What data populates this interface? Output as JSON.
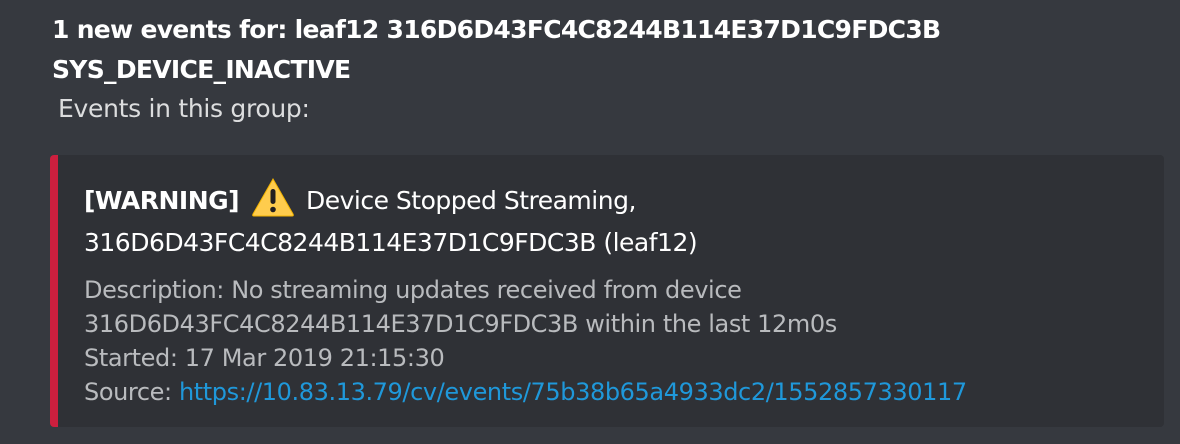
{
  "message": {
    "title_line1": "1 new events for: leaf12 316D6D43FC4C8244B114E37D1C9FDC3B",
    "title_line2": "SYS_DEVICE_INACTIVE",
    "subtitle": "Events in this group:"
  },
  "embed": {
    "accent_color": "#cc1f3e",
    "severity_tag": "[WARNING]",
    "icon": "warning-icon",
    "title_text": "Device Stopped Streaming,",
    "title_line2": "316D6D43FC4C8244B114E37D1C9FDC3B (leaf12)",
    "description_line1": "Description: No streaming updates received from device",
    "description_line2": "316D6D43FC4C8244B114E37D1C9FDC3B within the last 12m0s",
    "started_label": "Started: ",
    "started_value": "17 Mar 2019 21:15:30",
    "source_label": "Source: ",
    "source_url": "https://10.83.13.79/cv/events/75b38b65a4933dc2/1552857330117",
    "link_color": "#1f98da"
  }
}
